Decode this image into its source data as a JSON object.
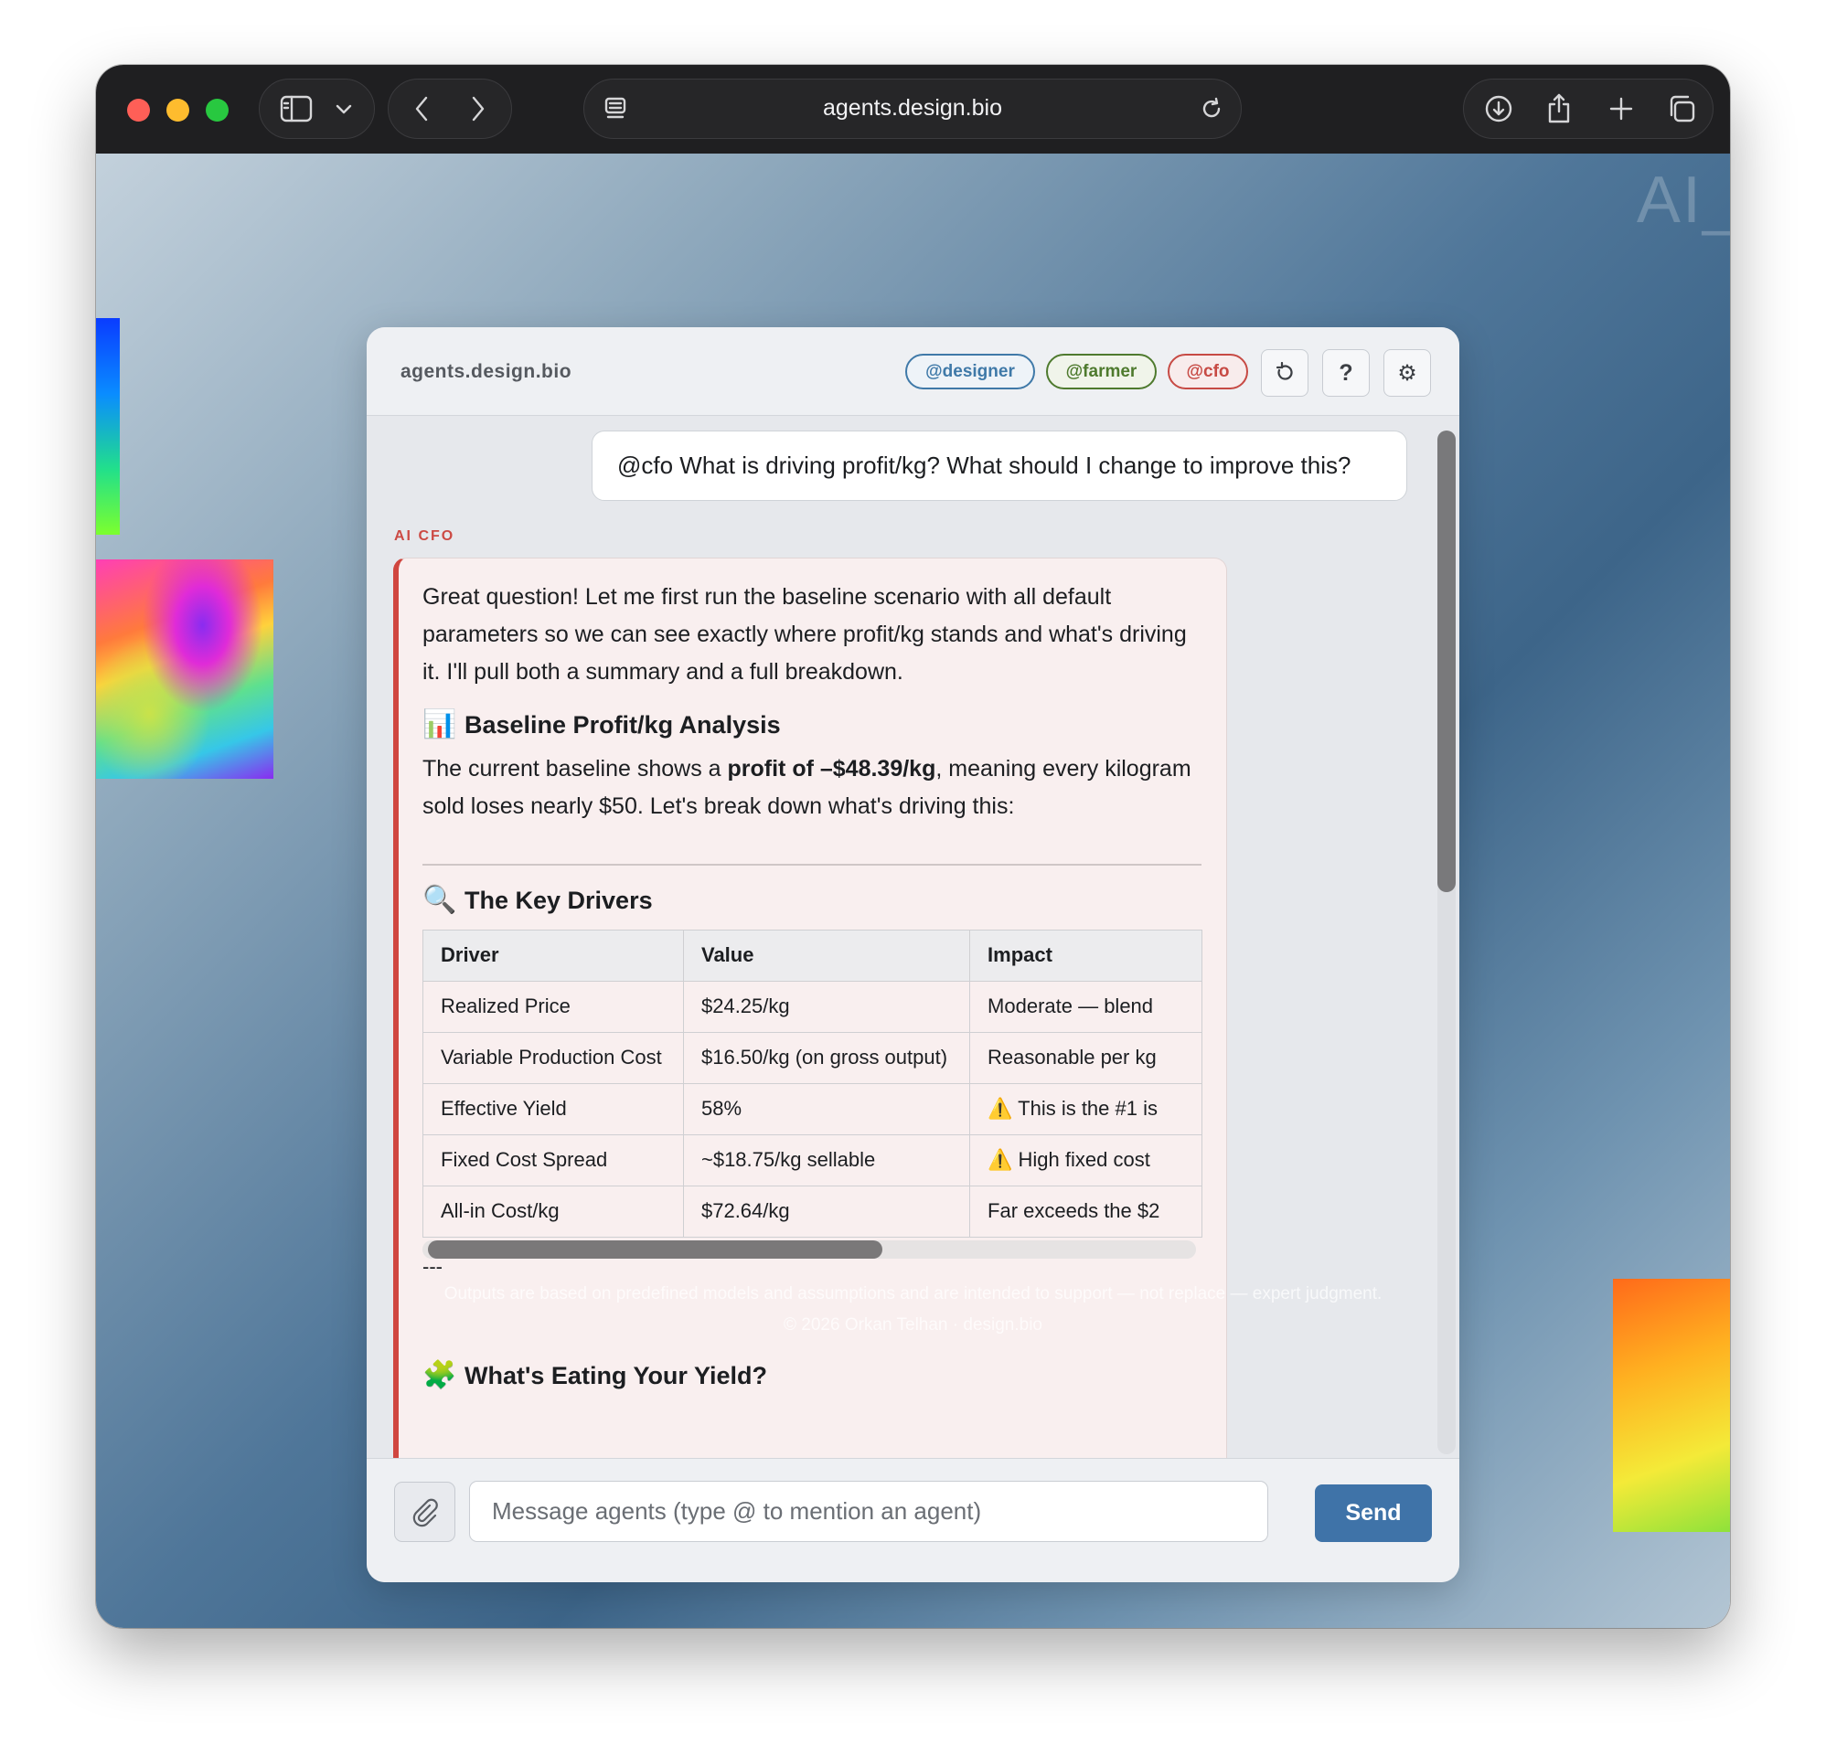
{
  "browser": {
    "url": "agents.design.bio",
    "icons": [
      "sidebar-icon",
      "chevron-down-icon",
      "back-icon",
      "forward-icon",
      "reader-icon",
      "reload-icon",
      "download-icon",
      "share-icon",
      "new-tab-icon",
      "tabs-overview-icon"
    ]
  },
  "background": {
    "corner_text": "AI_",
    "footer_disclaimer": "Outputs are based on predefined models and assumptions and are intended to support — not replace — expert judgment.",
    "footer_copyright": "© 2026 Orkan Telhan · design.bio"
  },
  "panel": {
    "brand": "agents.design.bio",
    "mentions": [
      {
        "label": "@designer",
        "color": "#3f79a8"
      },
      {
        "label": "@farmer",
        "color": "#4e7a2e"
      },
      {
        "label": "@cfo",
        "color": "#c74a44"
      }
    ],
    "buttons": {
      "reset_icon": "reset-icon",
      "help": "?",
      "settings_icon": "gear-icon"
    }
  },
  "chat": {
    "user_message": "@cfo What is driving profit/kg? What should I change to improve this?",
    "agent_name": "AI CFO",
    "intro": "Great question! Let me first run the baseline scenario with all default parameters so we can see exactly where profit/kg stands and what's driving it. I'll pull both a summary and a full breakdown.",
    "section1": {
      "emoji": "📊",
      "title": "Baseline Profit/kg Analysis",
      "text_before": "The current baseline shows a ",
      "text_bold": "profit of –$48.39/kg",
      "text_after": ", meaning every kilogram sold loses nearly $50. Let's break down what's driving this:"
    },
    "section2": {
      "emoji": "🔍",
      "title": "The Key Drivers",
      "headers": [
        "Driver",
        "Value",
        "Impact"
      ],
      "rows": [
        [
          "Realized Price",
          "$24.25/kg",
          "Moderate — blend"
        ],
        [
          "Variable Production Cost",
          "$16.50/kg (on gross output)",
          "Reasonable per kg"
        ],
        [
          "Effective Yield",
          "58%",
          "⚠️ This is the #1 is"
        ],
        [
          "Fixed Cost Spread",
          "~$18.75/kg sellable",
          "⚠️ High fixed cost"
        ],
        [
          "All-in Cost/kg",
          "$72.64/kg",
          "Far exceeds the $2"
        ]
      ],
      "separator": "---"
    },
    "section3": {
      "emoji": "🧩",
      "title": "What's Eating Your Yield?"
    }
  },
  "composer": {
    "attach_icon": "paperclip-icon",
    "placeholder": "Message agents (type @ to mention an agent)",
    "value": "",
    "send_label": "Send"
  },
  "colors": {
    "accent_blue": "#3f73a8",
    "cfo_red": "#d0463f",
    "titlebar": "#1f1f21"
  }
}
